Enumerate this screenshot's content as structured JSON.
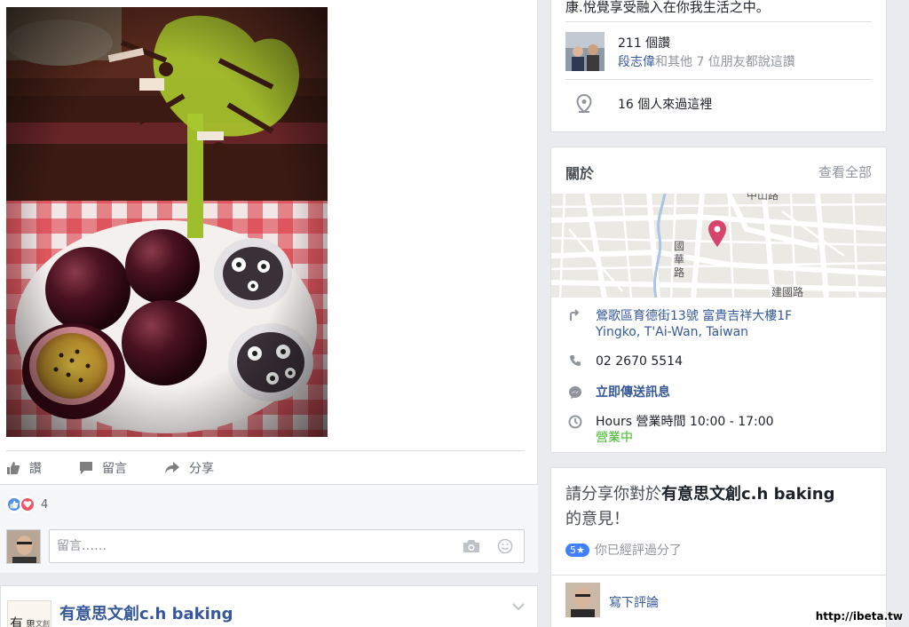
{
  "post": {
    "photo_alt": "passion fruit and cookies",
    "actions": [
      {
        "label": "讚",
        "icon": "thumbs-up-icon"
      },
      {
        "label": "留言",
        "icon": "comment-icon"
      },
      {
        "label": "分享",
        "icon": "share-icon"
      }
    ],
    "reaction_count": "4",
    "comment_placeholder": "留言……"
  },
  "next_post": {
    "page_name": "有意思文創c.h baking",
    "avatar_text_1": "有",
    "avatar_text_2": "思",
    "avatar_text_3": "文創"
  },
  "page_info": {
    "tagline": "康.悅覺享受融入在你我生活之中。",
    "likes_count": "211 個讚",
    "friend_name": "段志偉",
    "friends_liked_rest": "和其他 7 位朋友都說這讚",
    "checkins": "16 個人來過這裡"
  },
  "about": {
    "title": "關於",
    "see_all": "查看全部",
    "map_labels": {
      "road1": "中山路",
      "road2": "國",
      "road3": "華",
      "road4": "路",
      "road5": "建國路"
    },
    "address_line1": "鶯歌區育德街13號 富貴吉祥大樓1F",
    "address_line2": "Yingko, T'Ai-Wan, Taiwan",
    "phone": "02 2670 5514",
    "message": "立即傳送訊息",
    "hours": "Hours 營業時間 10:00 - 17:00",
    "open_status": "營業中"
  },
  "review": {
    "prompt_pre": "請分享你對於",
    "prompt_name": "有意思文創c.h baking",
    "prompt_post": "的意見！",
    "rating_badge": "5★",
    "rated_text": "你已經評過分了",
    "write_review": "寫下評論"
  },
  "watermark": "http://ibeta.tw",
  "colors": {
    "link": "#365899",
    "open_green": "#42b72a",
    "like_blue": "#4f8df7",
    "love_red": "#f25268",
    "map_pin": "#d6436a"
  }
}
